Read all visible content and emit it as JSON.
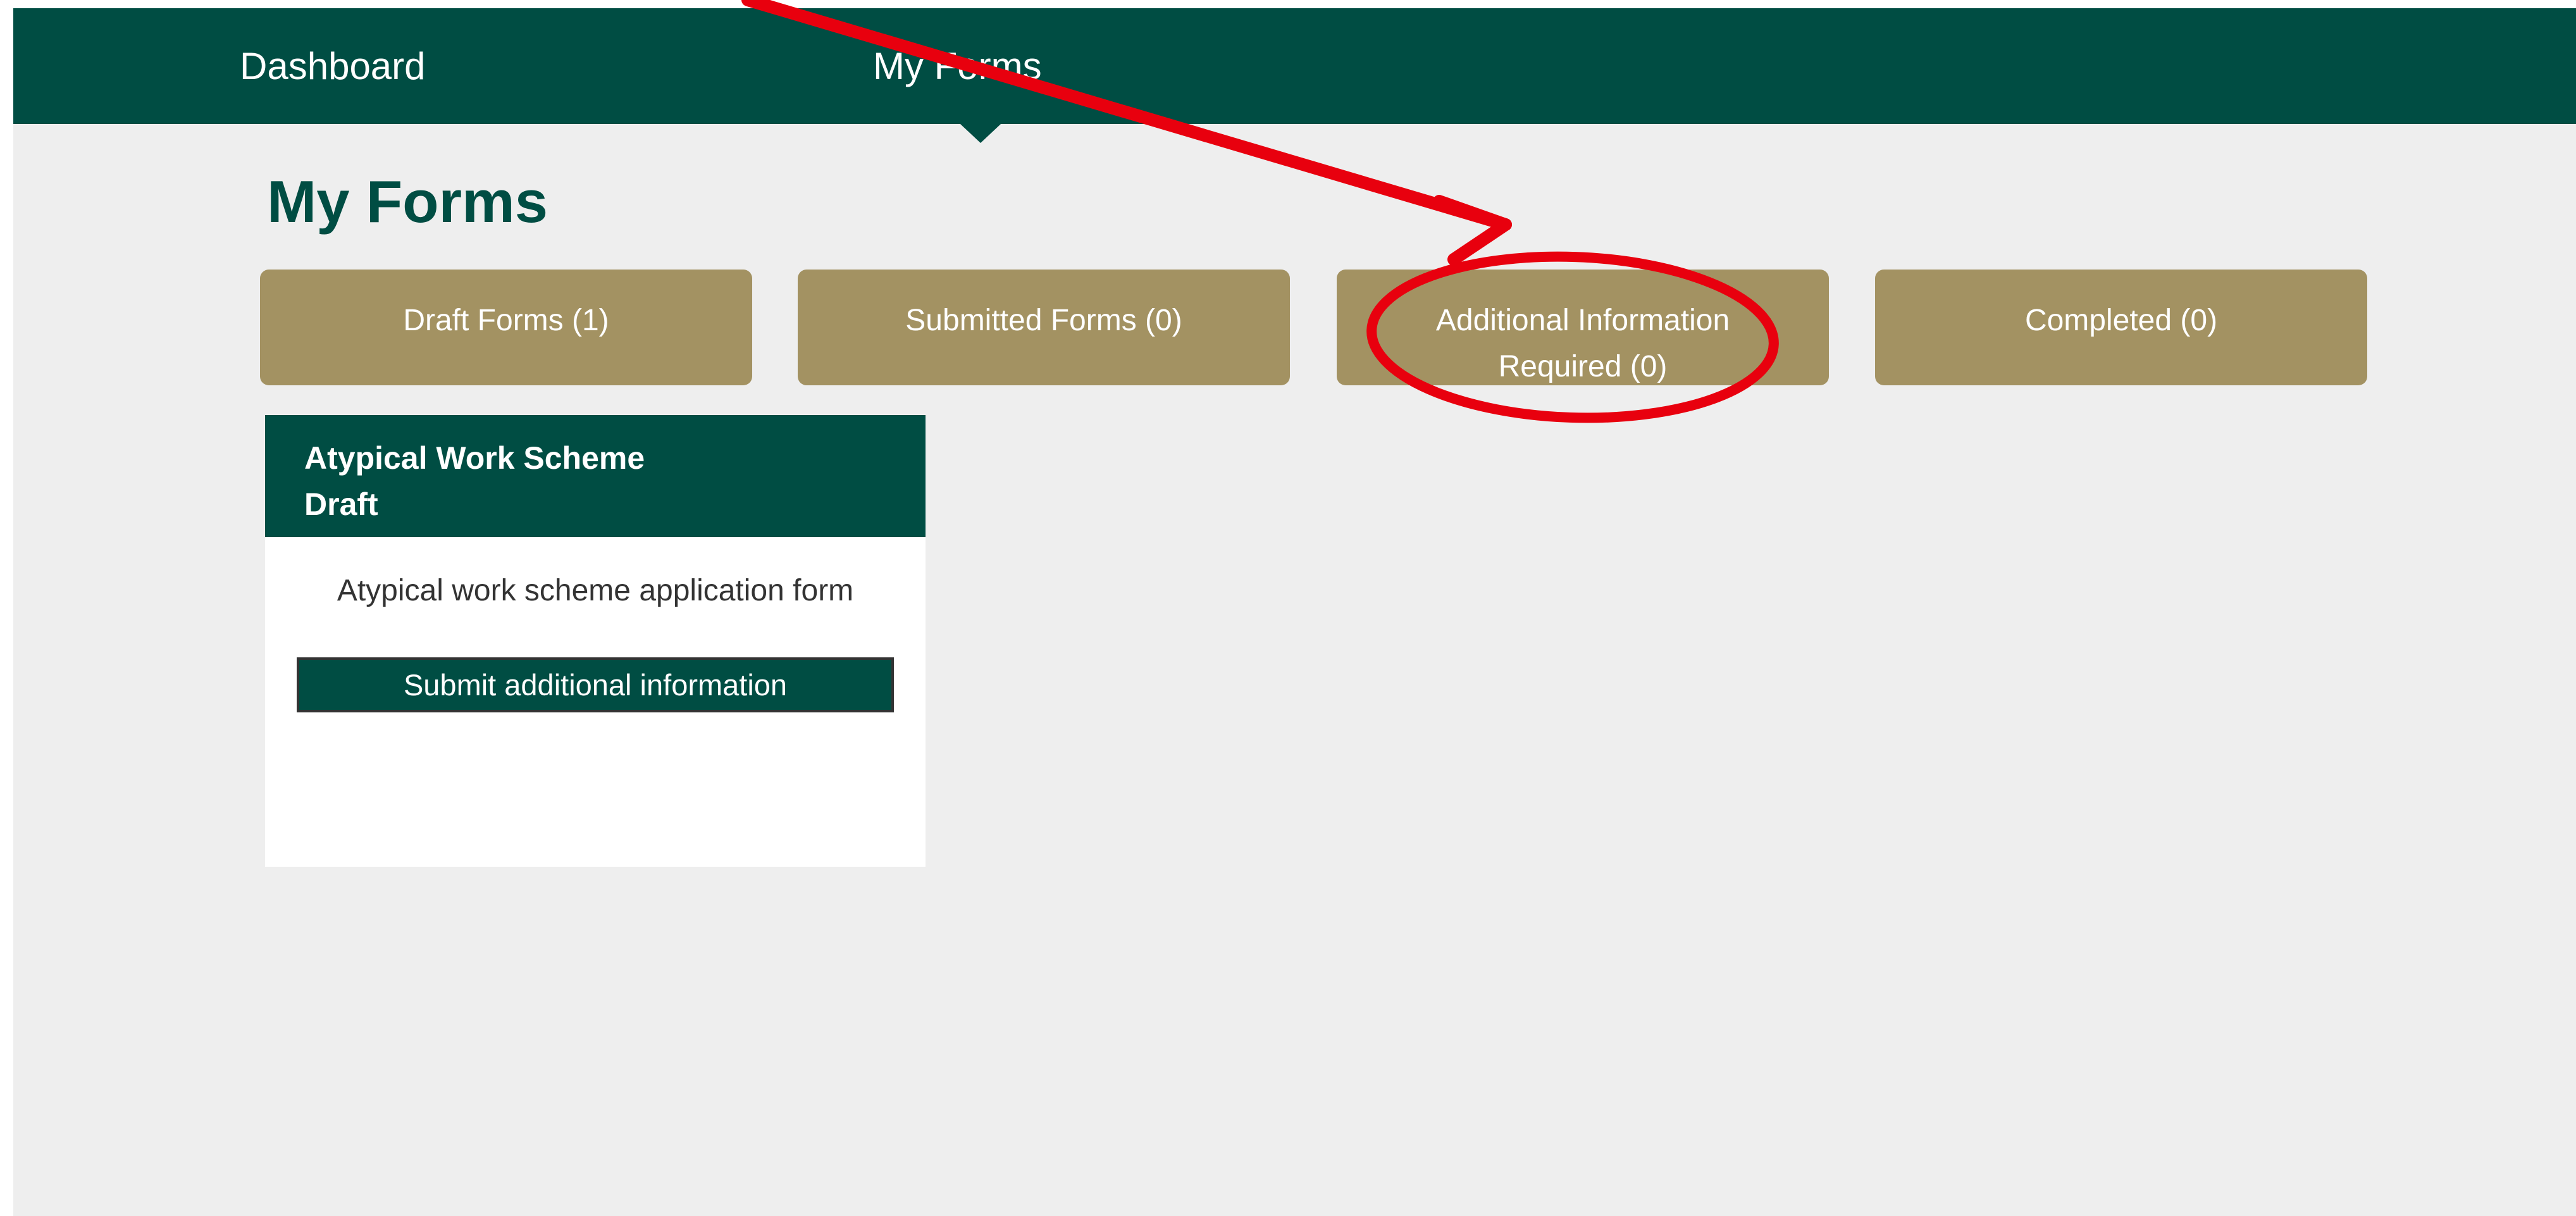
{
  "nav": {
    "items": [
      {
        "label": "Dashboard"
      },
      {
        "label": "My Forms"
      }
    ],
    "bg_color": "#004d43"
  },
  "page": {
    "title": "My Forms",
    "bg_color": "#eeeeee"
  },
  "tabs": [
    {
      "line1": "Draft Forms (1)",
      "line2": ""
    },
    {
      "line1": "Submitted Forms (0)",
      "line2": ""
    },
    {
      "line1": "Additional Information",
      "line2": "Required (0)"
    },
    {
      "line1": "Completed (0)",
      "line2": ""
    }
  ],
  "tab_color": "#a39262",
  "card": {
    "title": "Atypical Work Scheme",
    "status": "Draft",
    "description": "Atypical work scheme application form",
    "button_label": "Submit additional information",
    "header_color": "#004d43"
  },
  "annotation": {
    "color": "#e8000e",
    "shapes": [
      "arrow-icon",
      "ellipse-highlight"
    ]
  }
}
